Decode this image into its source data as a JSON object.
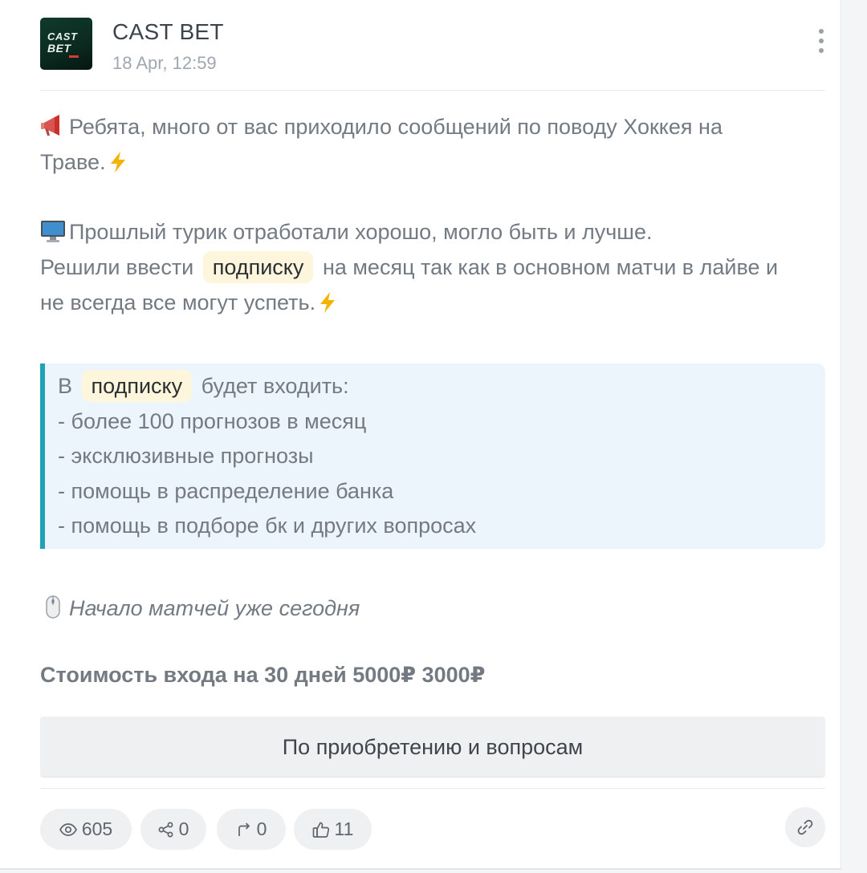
{
  "channel": {
    "name": "CAST BET",
    "date": "18 Apr, 12:59",
    "avatar_text": {
      "top": "CAST",
      "bottom": "BET"
    }
  },
  "post": {
    "p1_line1": "Ребята, много от вас приходило сообщений по поводу Хоккея на",
    "p1_line2": "Траве.",
    "p2_line1": "Прошлый турик отработали хорошо, могло быть и лучше.",
    "p2_line2_before": "Решили ввести",
    "p2_line2_chip": "подписку",
    "p2_line2_after": "на месяц так как в основном матчи в лайве и",
    "p2_line3": "не всегда все могут успеть.",
    "quote": {
      "line1_before": "В",
      "line1_chip": "подписку",
      "line1_after": "будет входить:",
      "items": [
        "- более 100 прогнозов в месяц",
        "- эксклюзивные прогнозы",
        "- помощь в распределение банка",
        "- помощь в подборе бк и других вопросах"
      ]
    },
    "italic_note": "Начало матчей уже сегодня",
    "price": "Стоимость входа на 30 дней 5000₽ 3000₽",
    "cta_label": "По приобретению и вопросам"
  },
  "stats": {
    "views": "605",
    "shares": "0",
    "forwards": "0",
    "likes": "11"
  },
  "icons": {
    "menu": "more-vertical-icon",
    "megaphone": "megaphone-icon",
    "lightning": "lightning-icon",
    "monitor": "monitor-icon",
    "mouse": "mouse-icon",
    "views": "eye-icon",
    "shares": "share-icon",
    "forwards": "forward-icon",
    "likes": "thumbs-up-icon",
    "link": "link-icon"
  },
  "colors": {
    "quote_border": "#1fa2b7",
    "quote_bg": "#edf5fc",
    "chip_bg": "#fdf6dc",
    "lightning": "#f5b301"
  }
}
